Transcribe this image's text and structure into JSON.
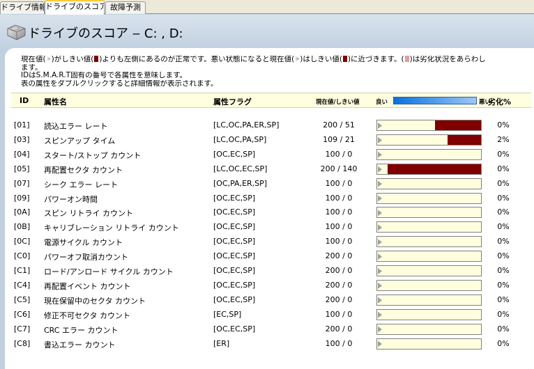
{
  "tabs": [
    {
      "label": "ドライブ情報"
    },
    {
      "label": "ドライブのスコア"
    },
    {
      "label": "故障予測"
    }
  ],
  "page_title": "ドライブのスコア ‒ C: , D:",
  "description": {
    "line1_a": "現在値(",
    "line1_b": ")がしきい値(",
    "line1_c": ")よりも左側にあるのが正常です。悪い状態になると現在値(",
    "line1_d": ")はしきい値(",
    "line1_e": ")に近づきます。(",
    "line1_f": ")は劣化状況をあらわし",
    "line2": "ます。",
    "line3": "IDはS.M.A.R.T固有の番号で各属性を意味します。",
    "line4": "表の属性をダブルクリックすると詳細情報が表示されます。"
  },
  "columns": {
    "id": "ID",
    "name": "属性名",
    "flag": "属性フラグ",
    "value": "現在値/しきい値",
    "good": "良い",
    "bad": "悪い",
    "wear": "劣化%"
  },
  "colors": {
    "bar_fill": "#800000",
    "bar_bg": "#ffffe0"
  },
  "rows": [
    {
      "id": "[01]",
      "name": "読込エラー レート",
      "flag": "[LC,OC,PA,ER,SP]",
      "value": "200 / 51",
      "fill": 0.44,
      "wear": "0%"
    },
    {
      "id": "[03]",
      "name": "スピンアップ タイム",
      "flag": "[LC,OC,PA,SP]",
      "value": "109 / 21",
      "fill": 0.32,
      "wear": "2%"
    },
    {
      "id": "[04]",
      "name": "スタート/ストップ カウント",
      "flag": "[OC,EC,SP]",
      "value": "100 / 0",
      "fill": 0,
      "wear": "0%"
    },
    {
      "id": "[05]",
      "name": "再配置セクタ カウント",
      "flag": "[LC,OC,EC,SP]",
      "value": "200 / 140",
      "fill": 0.9,
      "wear": "0%"
    },
    {
      "id": "[07]",
      "name": "シーク エラー レート",
      "flag": "[OC,PA,ER,SP]",
      "value": "100 / 0",
      "fill": 0,
      "wear": "0%"
    },
    {
      "id": "[09]",
      "name": "パワーオン時間",
      "flag": "[OC,EC,SP]",
      "value": "100 / 0",
      "fill": 0,
      "wear": "0%"
    },
    {
      "id": "[0A]",
      "name": "スピン リトライ カウント",
      "flag": "[OC,EC,SP]",
      "value": "100 / 0",
      "fill": 0,
      "wear": "0%"
    },
    {
      "id": "[0B]",
      "name": "キャリブレーション リトライ カウント",
      "flag": "[OC,EC,SP]",
      "value": "100 / 0",
      "fill": 0,
      "wear": "0%"
    },
    {
      "id": "[0C]",
      "name": "電源サイクル カウント",
      "flag": "[OC,EC,SP]",
      "value": "100 / 0",
      "fill": 0,
      "wear": "0%"
    },
    {
      "id": "[C0]",
      "name": "パワーオフ取消カウント",
      "flag": "[OC,EC,SP]",
      "value": "200 / 0",
      "fill": 0,
      "wear": "0%"
    },
    {
      "id": "[C1]",
      "name": "ロード/アンロード サイクル カウント",
      "flag": "[OC,EC,SP]",
      "value": "200 / 0",
      "fill": 0,
      "wear": "0%"
    },
    {
      "id": "[C4]",
      "name": "再配置イベント カウント",
      "flag": "[OC,EC,SP]",
      "value": "200 / 0",
      "fill": 0,
      "wear": "0%"
    },
    {
      "id": "[C5]",
      "name": "現在保留中のセクタ カウント",
      "flag": "[OC,EC,SP]",
      "value": "200 / 0",
      "fill": 0,
      "wear": "0%"
    },
    {
      "id": "[C6]",
      "name": "修正不可セクタ カウント",
      "flag": "[EC,SP]",
      "value": "100 / 0",
      "fill": 0,
      "wear": "0%"
    },
    {
      "id": "[C7]",
      "name": "CRC エラー カウント",
      "flag": "[OC,EC,SP]",
      "value": "200 / 0",
      "fill": 0,
      "wear": "0%"
    },
    {
      "id": "[C8]",
      "name": "書込エラー カウント",
      "flag": "[ER]",
      "value": "100 / 0",
      "fill": 0,
      "wear": "0%"
    }
  ]
}
